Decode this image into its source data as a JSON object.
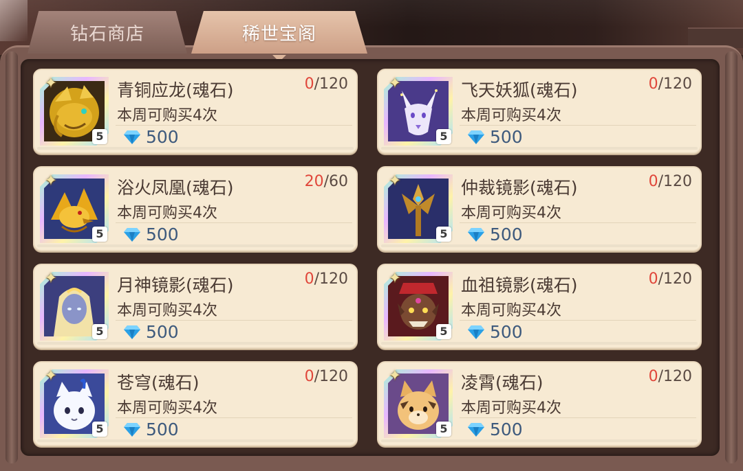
{
  "tabs": [
    {
      "label": "钻石商店",
      "active": false
    },
    {
      "label": "稀世宝阁",
      "active": true
    }
  ],
  "items": [
    {
      "name": "青铜应龙(魂石)",
      "limit": "本周可购买4次",
      "owned": "0",
      "total": "/120",
      "price": "500",
      "level": "5",
      "icon": "golden-dragon-portrait"
    },
    {
      "name": "飞天妖狐(魂石)",
      "limit": "本周可购买4次",
      "owned": "0",
      "total": "/120",
      "price": "500",
      "level": "5",
      "icon": "white-fox-portrait"
    },
    {
      "name": "浴火凤凰(魂石)",
      "limit": "本周可购买4次",
      "owned": "20",
      "total": "/60",
      "price": "500",
      "level": "5",
      "icon": "phoenix-portrait"
    },
    {
      "name": "仲裁镜影(魂石)",
      "limit": "本周可购买4次",
      "owned": "0",
      "total": "/120",
      "price": "500",
      "level": "5",
      "icon": "trident-portrait"
    },
    {
      "name": "月神镜影(魂石)",
      "limit": "本周可购买4次",
      "owned": "0",
      "total": "/120",
      "price": "500",
      "level": "5",
      "icon": "moon-goddess-portrait"
    },
    {
      "name": "血祖镜影(魂石)",
      "limit": "本周可购买4次",
      "owned": "0",
      "total": "/120",
      "price": "500",
      "level": "5",
      "icon": "blood-ancestor-portrait"
    },
    {
      "name": "苍穹(魂石)",
      "limit": "本周可购买4次",
      "owned": "0",
      "total": "/120",
      "price": "500",
      "level": "5",
      "icon": "white-cat-portrait"
    },
    {
      "name": "凌霄(魂石)",
      "limit": "本周可购买4次",
      "owned": "0",
      "total": "/120",
      "price": "500",
      "level": "5",
      "icon": "tan-cat-portrait"
    }
  ],
  "colors": {
    "owned_highlight": "#e0463a",
    "price_text": "#3e5a7d",
    "card_bg": "#f7ead3"
  }
}
